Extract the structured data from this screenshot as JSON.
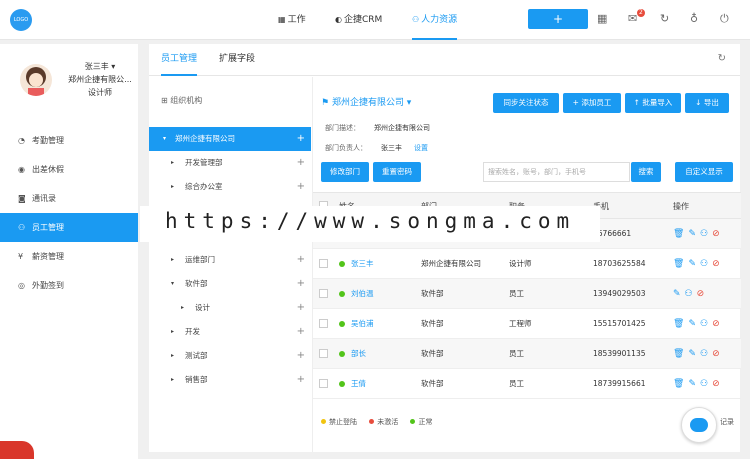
{
  "header": {
    "logo": "LOGO",
    "nav": [
      {
        "icon": "work-icon",
        "glyph": "▦",
        "label": "工作"
      },
      {
        "icon": "crm-icon",
        "glyph": "◐",
        "label": "企捷CRM"
      },
      {
        "icon": "hr-icon",
        "glyph": "⚇",
        "label": "人力资源"
      }
    ],
    "add_label": "+",
    "notification_count": "2"
  },
  "sidebar": {
    "user_name": "张三丰 ▾",
    "company": "郑州企捷有限公...",
    "role": "设计师",
    "items": [
      {
        "label": "考勤管理",
        "glyph": "◔"
      },
      {
        "label": "出差休假",
        "glyph": "◉"
      },
      {
        "label": "通讯录",
        "glyph": "◙"
      },
      {
        "label": "员工管理",
        "glyph": "⚇"
      },
      {
        "label": "薪资管理",
        "glyph": "¥"
      },
      {
        "label": "外勤签到",
        "glyph": "◎"
      }
    ]
  },
  "tabs": [
    "员工管理",
    "扩展字段"
  ],
  "tree": {
    "title": "⊞ 组织机构",
    "nodes": [
      {
        "label": "郑州企捷有限公司",
        "arrow": "▾"
      },
      {
        "label": "开发管理部",
        "arrow": "▸"
      },
      {
        "label": "综合办公室",
        "arrow": "▸"
      },
      {
        "label": "开发部",
        "arrow": "▾"
      },
      {
        "label": "运维部门",
        "arrow": "▸"
      },
      {
        "label": "软件部",
        "arrow": "▾"
      },
      {
        "label": "设计",
        "arrow": "▸"
      },
      {
        "label": "开发",
        "arrow": "▸"
      },
      {
        "label": "测试部",
        "arrow": "▸"
      },
      {
        "label": "销售部",
        "arrow": "▸"
      }
    ],
    "plus": "+"
  },
  "content": {
    "company_title": "郑州企捷有限公司 ▾",
    "buttons": {
      "sync": "同步关注状态",
      "add": "+ 添加员工",
      "import": "↑ 批量导入",
      "export": "↓ 导出",
      "edit_dept": "修改部门",
      "reset_pwd": "重置密码",
      "search": "搜索",
      "custom": "自定义显示"
    },
    "dept_desc_label": "部门描述：",
    "dept_desc_value": "郑州企捷有限公司",
    "dept_owner_label": "部门负责人：",
    "dept_owner_value": "张三丰",
    "dept_owner_link": "设置",
    "search_placeholder": "搜索姓名，账号，部门，手机号"
  },
  "table": {
    "headers": [
      "姓名",
      "部门",
      "职务",
      "手机",
      "操作"
    ],
    "rows": [
      {
        "name": "",
        "dept": "",
        "title": "",
        "phone": "36766661",
        "status": "green"
      },
      {
        "name": "张三丰",
        "dept": "郑州企捷有限公司",
        "title": "设计师",
        "phone": "18703625584",
        "status": "green"
      },
      {
        "name": "刘伯温",
        "dept": "软件部",
        "title": "员工",
        "phone": "13949029503",
        "status": "green"
      },
      {
        "name": "吴伯浦",
        "dept": "软件部",
        "title": "工程师",
        "phone": "15515701425",
        "status": "green"
      },
      {
        "name": "部长",
        "dept": "软件部",
        "title": "员工",
        "phone": "18539901135",
        "status": "green"
      },
      {
        "name": "王倩",
        "dept": "软件部",
        "title": "员工",
        "phone": "18739915661",
        "status": "green"
      }
    ]
  },
  "legend": [
    {
      "label": "禁止登陆",
      "color": "#f1c40f"
    },
    {
      "label": "未激活",
      "color": "#e74c3c"
    },
    {
      "label": "正常",
      "color": "#52c41a"
    }
  ],
  "footer_text": "记录",
  "watermark": "https://www.songma.com"
}
